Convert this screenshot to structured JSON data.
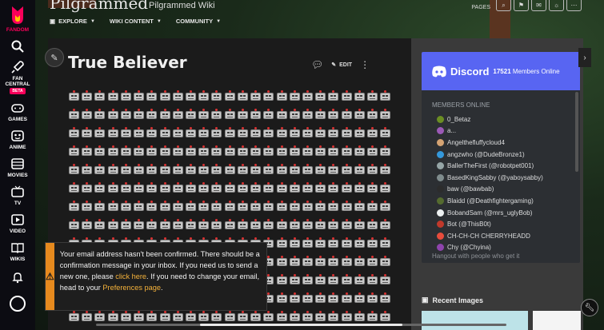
{
  "rail": {
    "brand": "FANDOM",
    "items": [
      {
        "label": "FAN CENTRAL",
        "badge": "BETA",
        "icon": "rocket-icon"
      },
      {
        "label": "GAMES",
        "icon": "gamepad-icon"
      },
      {
        "label": "ANIME",
        "icon": "anime-icon"
      },
      {
        "label": "MOVIES",
        "icon": "film-icon"
      },
      {
        "label": "TV",
        "icon": "tv-icon"
      },
      {
        "label": "VIDEO",
        "icon": "play-icon"
      },
      {
        "label": "WIKIS",
        "icon": "book-icon"
      }
    ]
  },
  "header": {
    "wiki_title": "Pilgrammed",
    "wiki_subtitle": "Pilgrammed Wiki",
    "nav": [
      "EXPLORE",
      "WIKI CONTENT",
      "COMMUNITY"
    ],
    "pages_label": "PAGES"
  },
  "article": {
    "title": "True Believer",
    "edit_label": "EDIT",
    "robot_rows": 13,
    "robots_per_row": 25
  },
  "discord": {
    "brand": "Discord",
    "count": "17521",
    "count_label": "Members Online",
    "members_header": "MEMBERS ONLINE",
    "members": [
      {
        "name": "0_Betaz",
        "color": "#6b8e23"
      },
      {
        "name": "a...",
        "color": "#9b59b6"
      },
      {
        "name": "Angelthefluffycloud4",
        "color": "#d4a373"
      },
      {
        "name": "angzwho (@DudeBronze1)",
        "color": "#3498db"
      },
      {
        "name": "BallerTheFirst (@robotpet001)",
        "color": "#95a5a6"
      },
      {
        "name": "BasedKingSabby (@yaboysabby)",
        "color": "#7f8c8d"
      },
      {
        "name": "baw (@bawbab)",
        "color": "#2c2c2c"
      },
      {
        "name": "Blaidd (@Deathfightergaming)",
        "color": "#556b2f"
      },
      {
        "name": "BobandSam (@mrs_uglyBob)",
        "color": "#ecf0f1"
      },
      {
        "name": "Bot (@ThisB0t)",
        "color": "#c0392b"
      },
      {
        "name": "CH-CH-CH CHERRYHEADD",
        "color": "#e74c3c"
      },
      {
        "name": "Chy (@Chyina)",
        "color": "#8e44ad"
      }
    ],
    "footer": "Hangout with people who get it"
  },
  "recent_images": {
    "label": "Recent Images"
  },
  "notice": {
    "text_before": "Your email address hasn't been confirmed. There should be a confirmation message in your inbox. If you need us to send a new one, please ",
    "link1": "click here",
    "text_middle": ". If you need to change your email, head to your ",
    "link2": "Preferences page",
    "text_after": "."
  },
  "colors": {
    "fandom_pink": "#fa005a",
    "discord_blurple": "#5865f2",
    "notice_orange": "#e68a1e",
    "link_gold": "#f5b23b"
  }
}
